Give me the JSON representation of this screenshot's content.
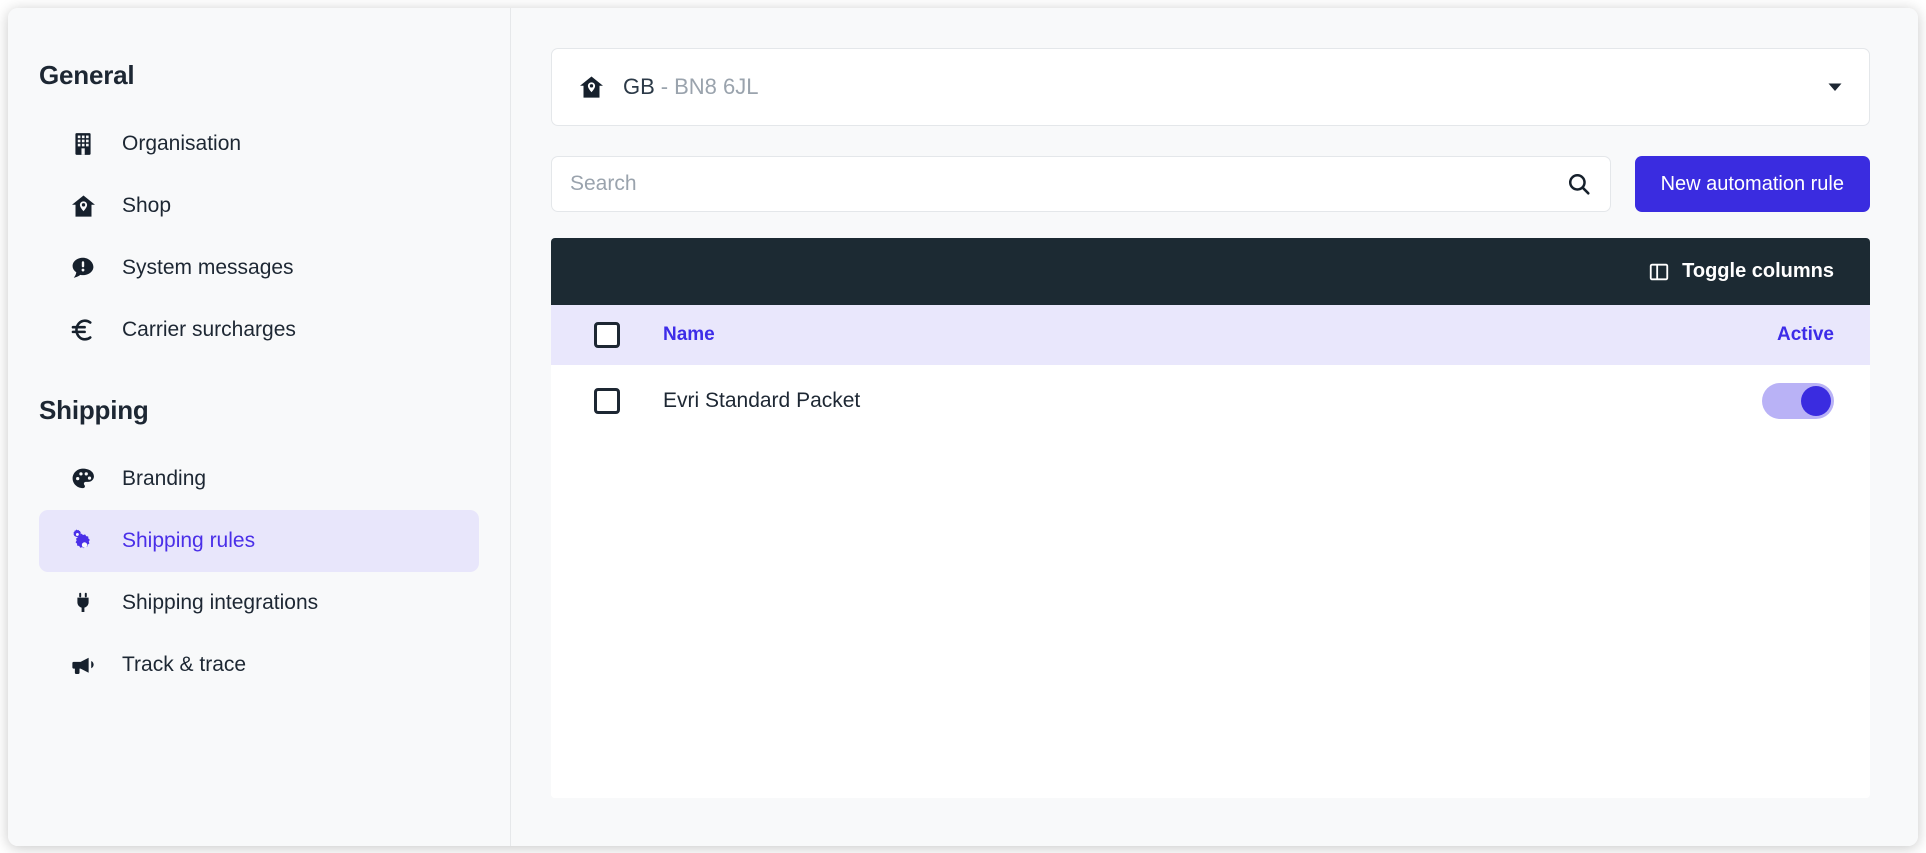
{
  "sidebar": {
    "sections": [
      {
        "title": "General",
        "items": [
          {
            "label": "Organisation",
            "icon": "building-icon",
            "active": false
          },
          {
            "label": "Shop",
            "icon": "shop-home-icon",
            "active": false
          },
          {
            "label": "System messages",
            "icon": "message-alert-icon",
            "active": false
          },
          {
            "label": "Carrier surcharges",
            "icon": "euro-icon",
            "active": false
          }
        ]
      },
      {
        "title": "Shipping",
        "items": [
          {
            "label": "Branding",
            "icon": "palette-icon",
            "active": false
          },
          {
            "label": "Shipping rules",
            "icon": "gears-icon",
            "active": true
          },
          {
            "label": "Shipping integrations",
            "icon": "plug-icon",
            "active": false
          },
          {
            "label": "Track & trace",
            "icon": "megaphone-icon",
            "active": false
          }
        ]
      }
    ]
  },
  "location": {
    "icon": "shop-home-icon",
    "country": "GB",
    "separator": "-",
    "postcode": "BN8 6JL",
    "caret_icon": "chevron-down-icon"
  },
  "search": {
    "placeholder": "Search",
    "value": "",
    "icon": "search-icon"
  },
  "actions": {
    "new_rule_label": "New automation rule"
  },
  "table": {
    "toolbar": {
      "toggle_columns_label": "Toggle columns",
      "toggle_columns_icon": "columns-icon"
    },
    "columns": {
      "name": "Name",
      "active": "Active"
    },
    "rows": [
      {
        "name": "Evri Standard Packet",
        "active": true,
        "selected": false
      }
    ]
  },
  "colors": {
    "accent": "#3a2ce0",
    "accent_text": "#3d2ce8",
    "toolbar_dark": "#1c2a33",
    "header_lavender": "#e9e7fc",
    "sidebar_bg": "#f8f9fa",
    "active_nav_bg": "#e8e6fb"
  }
}
